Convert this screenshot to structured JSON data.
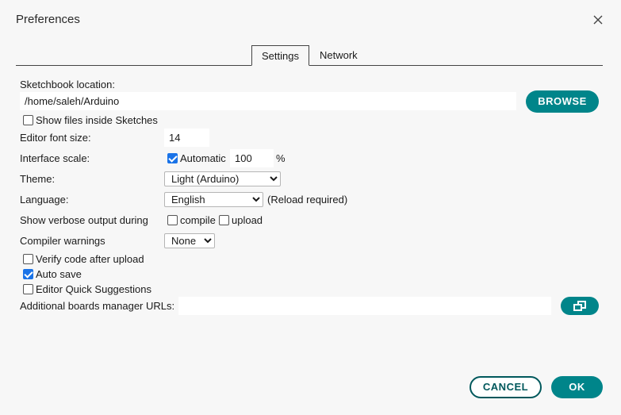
{
  "window": {
    "title": "Preferences"
  },
  "tabs": {
    "settings": "Settings",
    "network": "Network"
  },
  "sketchbook": {
    "label": "Sketchbook location:",
    "path": "/home/saleh/Arduino",
    "browse": "BROWSE",
    "show_files": "Show files inside Sketches",
    "show_files_checked": false
  },
  "font_size": {
    "label": "Editor font size:",
    "value": "14"
  },
  "interface_scale": {
    "label": "Interface scale:",
    "automatic": "Automatic",
    "automatic_checked": true,
    "value": "100",
    "unit": "%"
  },
  "theme": {
    "label": "Theme:",
    "selected": "Light (Arduino)"
  },
  "language": {
    "label": "Language:",
    "selected": "English",
    "note": "(Reload required)"
  },
  "verbose": {
    "label": "Show verbose output during",
    "compile": "compile",
    "compile_checked": false,
    "upload": "upload",
    "upload_checked": false
  },
  "warnings": {
    "label": "Compiler warnings",
    "selected": "None"
  },
  "options": {
    "verify": {
      "label": "Verify code after upload",
      "checked": false
    },
    "autosave": {
      "label": "Auto save",
      "checked": true
    },
    "quick": {
      "label": "Editor Quick Suggestions",
      "checked": false
    }
  },
  "boards": {
    "label": "Additional boards manager URLs:",
    "value": ""
  },
  "footer": {
    "cancel": "CANCEL",
    "ok": "OK"
  },
  "colors": {
    "accent": "#00858a",
    "outline": "#00585c",
    "checkbox": "#1a73e8",
    "background": "#f7f7f7"
  }
}
